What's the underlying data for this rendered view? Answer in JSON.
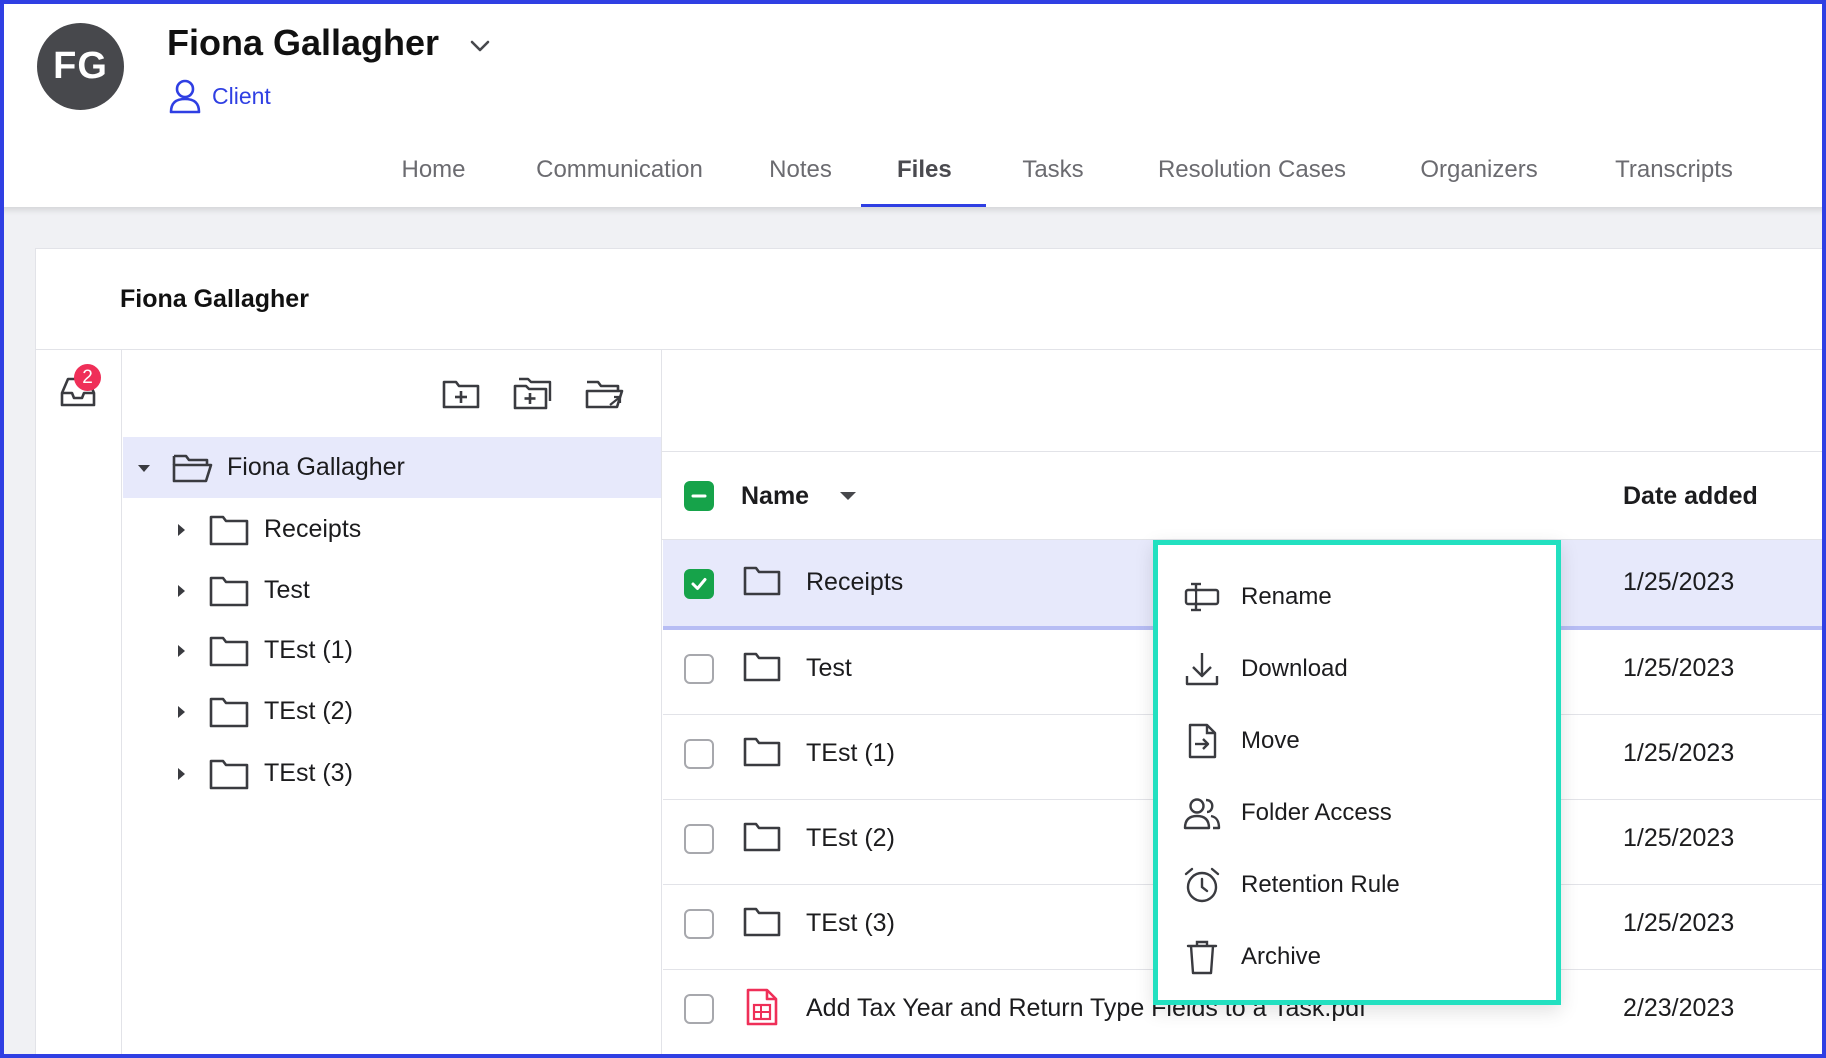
{
  "header": {
    "avatar_initials": "FG",
    "client_name": "Fiona Gallagher",
    "role": "Client",
    "tabs": [
      {
        "label": "Home",
        "active": false
      },
      {
        "label": "Communication",
        "active": false
      },
      {
        "label": "Notes",
        "active": false
      },
      {
        "label": "Files",
        "active": true
      },
      {
        "label": "Tasks",
        "active": false
      },
      {
        "label": "Resolution Cases",
        "active": false
      },
      {
        "label": "Organizers",
        "active": false
      },
      {
        "label": "Transcripts",
        "active": false
      }
    ]
  },
  "panel": {
    "title": "Fiona Gallagher",
    "inbox_badge": "2"
  },
  "tree": {
    "root": "Fiona Gallagher",
    "children": [
      "Receipts",
      "Test",
      "TEst (1)",
      "TEst (2)",
      "TEst (3)"
    ]
  },
  "table": {
    "col_name": "Name",
    "col_date": "Date added",
    "rows": [
      {
        "name": "Receipts",
        "type": "folder",
        "date": "1/25/2023",
        "checked": true
      },
      {
        "name": "Test",
        "type": "folder",
        "date": "1/25/2023",
        "checked": false
      },
      {
        "name": "TEst (1)",
        "type": "folder",
        "date": "1/25/2023",
        "checked": false
      },
      {
        "name": "TEst (2)",
        "type": "folder",
        "date": "1/25/2023",
        "checked": false
      },
      {
        "name": "TEst (3)",
        "type": "folder",
        "date": "1/25/2023",
        "checked": false
      },
      {
        "name": "Add Tax Year and Return Type Fields to a Task.pdf",
        "type": "pdf",
        "date": "2/23/2023",
        "checked": false
      }
    ]
  },
  "context_menu": {
    "items": [
      "Rename",
      "Download",
      "Move",
      "Folder Access",
      "Retention Rule",
      "Archive"
    ]
  },
  "colors": {
    "accent": "#2f3fe3",
    "menu_border": "#22e0c0",
    "checkbox_on": "#16a34a",
    "badge": "#ef2f58",
    "selected_row": "#e7e9fb"
  }
}
